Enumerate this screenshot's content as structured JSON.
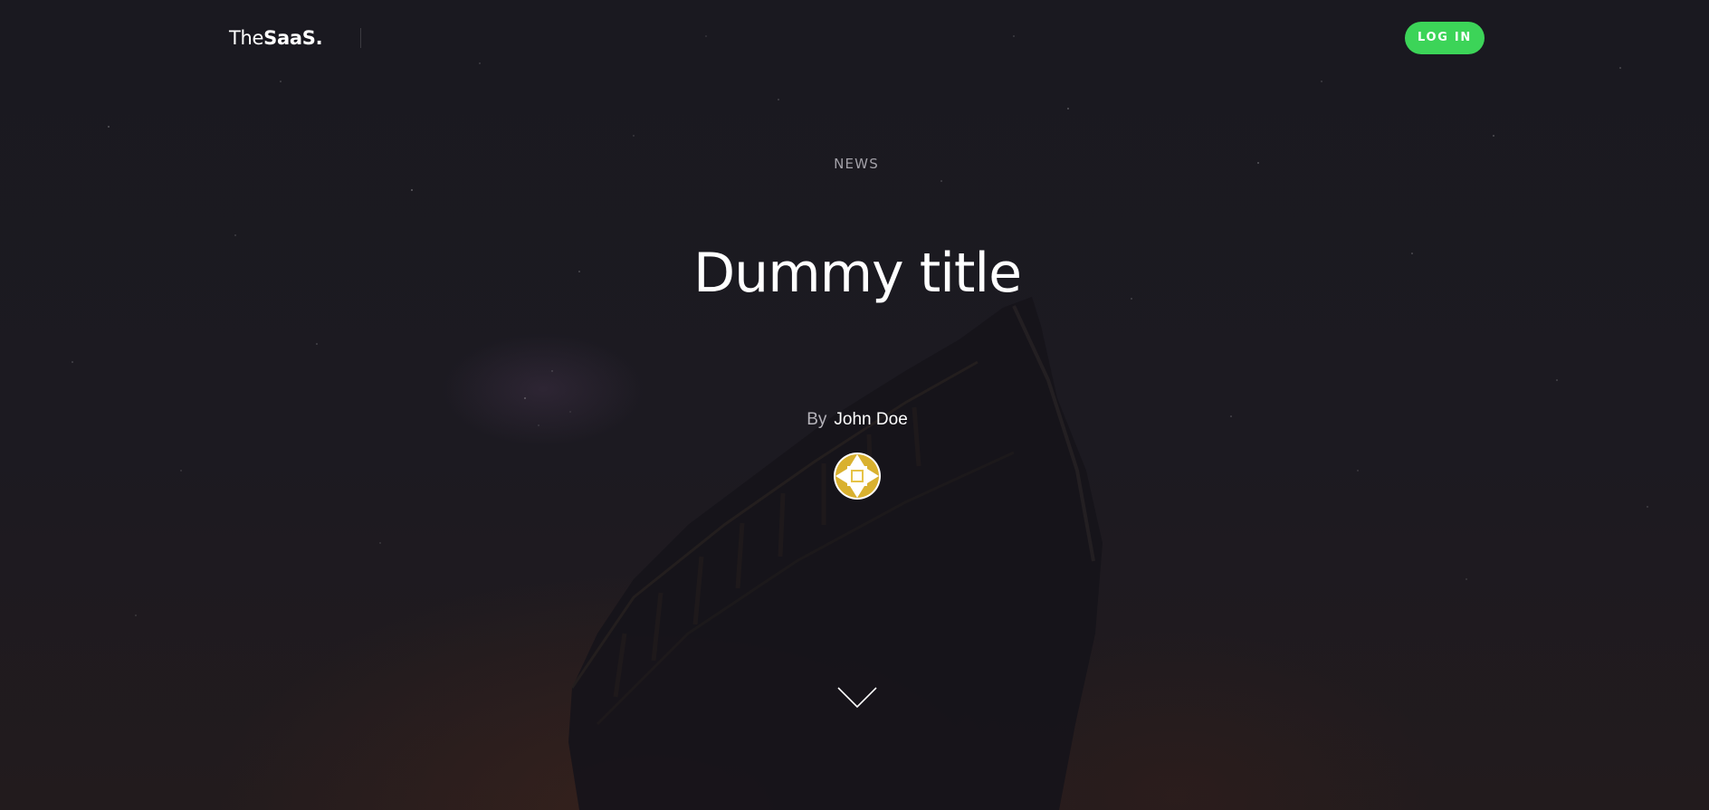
{
  "header": {
    "logo_light": "The",
    "logo_bold": "SaaS.",
    "login_label": "LOG IN"
  },
  "hero": {
    "category": "NEWS",
    "title": "Dummy title",
    "by_label": "By",
    "author": "John Doe"
  },
  "icons": {
    "avatar": "avatar-pattern-icon",
    "scroll": "chevron-down-icon"
  },
  "colors": {
    "accent": "#3cd458",
    "background": "#1b1920",
    "avatar": "#d9b12f"
  }
}
